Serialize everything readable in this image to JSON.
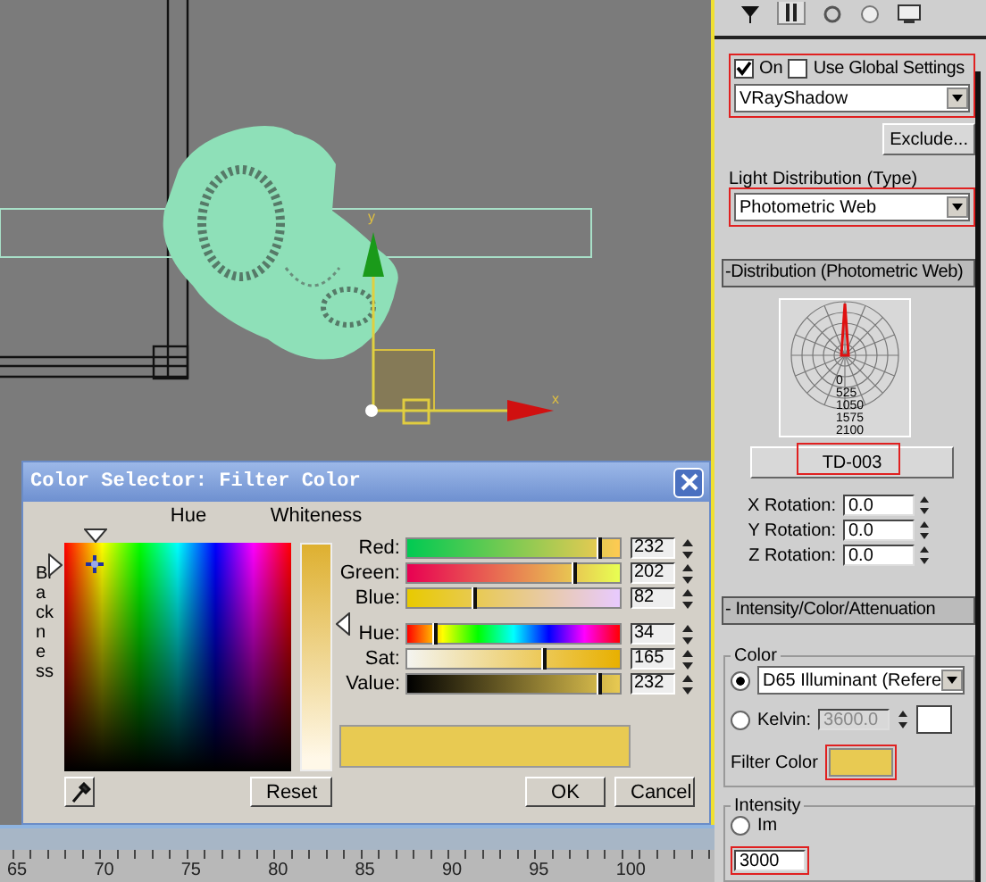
{
  "viewport": {
    "axis_labels": [
      {
        "kind": "y",
        "text": "y"
      },
      {
        "kind": "x",
        "text": "x"
      }
    ],
    "ruler": [
      "65",
      "70",
      "75",
      "80",
      "85",
      "90",
      "95",
      "100"
    ]
  },
  "panel": {
    "shadows": {
      "highlighted": true,
      "on": {
        "label": "On",
        "checked": true
      },
      "global": {
        "label": "Use Global Settings",
        "checked": false
      },
      "type": "VRayShadow"
    },
    "exclude_button": "Exclude...",
    "light_distribution": {
      "highlighted": true,
      "label": "Light Distribution (Type)",
      "value": "Photometric Web"
    },
    "distribution_rollout": {
      "title": "-Distribution (Photometric Web)",
      "web_labels": [
        "0",
        "525",
        "1050",
        "1575",
        "2100"
      ],
      "file_button": {
        "label": "TD-003",
        "highlighted": true
      },
      "rotations": [
        {
          "label": "X Rotation:",
          "value": "0.0"
        },
        {
          "label": "Y Rotation:",
          "value": "0.0"
        },
        {
          "label": "Z Rotation:",
          "value": "0.0"
        }
      ]
    },
    "intensity_rollout": {
      "title": "- Intensity/Color/Attenuation",
      "color_group": {
        "title": "Color",
        "preset": {
          "selected": true,
          "value": "D65 Illuminant (Refere"
        },
        "kelvin": {
          "selected": false,
          "label": "Kelvin:",
          "value": "3600.0"
        },
        "filter": {
          "label": "Filter Color",
          "color": "#e8ca52",
          "highlighted": true
        }
      },
      "intensity_group": {
        "title": "Intensity",
        "unit": {
          "label": "Im",
          "selected": false
        },
        "value": "3000",
        "highlighted": true
      }
    }
  },
  "dialog": {
    "title": "Color Selector: Filter Color",
    "hue_label": "Hue",
    "whiteness_label": "Whiteness",
    "blackness_label": "Blackness",
    "sliders": [
      {
        "label": "Red:",
        "value": "232",
        "level": 0.91
      },
      {
        "label": "Green:",
        "value": "202",
        "level": 0.79
      },
      {
        "label": "Blue:",
        "value": "82",
        "level": 0.32
      },
      {
        "label": "Hue:",
        "value": "34",
        "level": 0.133
      },
      {
        "label": "Sat:",
        "value": "165",
        "level": 0.647
      },
      {
        "label": "Value:",
        "value": "232",
        "level": 0.91
      }
    ],
    "color": "#e8ca52",
    "reset_button": "Reset",
    "ok_button": "OK",
    "cancel_button": "Cancel"
  }
}
